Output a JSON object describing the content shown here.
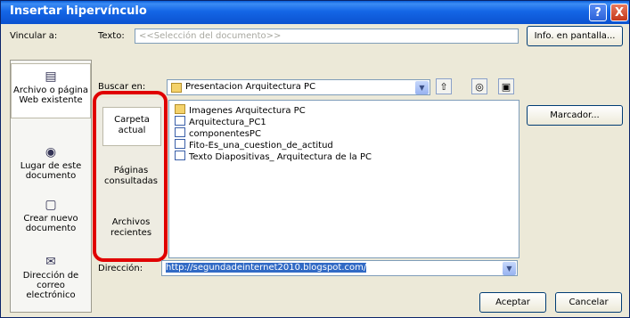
{
  "title": "Insertar hipervínculo",
  "title_buttons": {
    "help": "?",
    "close": "X"
  },
  "link_to_label": "Vincular a:",
  "text_label": "Texto:",
  "text_value": "<<Selección del documento>>",
  "screen_tip_button": "Info. en pantalla...",
  "look_in_label": "Buscar en:",
  "look_in_value": "Presentacion Arquitectura PC",
  "left_links": [
    {
      "label": "Archivo o página Web existente",
      "icon": "globe-document-icon"
    },
    {
      "label": "Lugar de este documento",
      "icon": "place-in-document-icon"
    },
    {
      "label": "Crear nuevo documento",
      "icon": "new-document-icon"
    },
    {
      "label": "Dirección de correo electrónico",
      "icon": "email-icon"
    }
  ],
  "mid_links": [
    {
      "label": "Carpeta actual"
    },
    {
      "label": "Páginas consultadas"
    },
    {
      "label": "Archivos recientes"
    }
  ],
  "files": [
    {
      "name": "Imagenes Arquitectura PC",
      "icon": "folder-icon"
    },
    {
      "name": "Arquitectura_PC1",
      "icon": "document-icon"
    },
    {
      "name": "componentesPC",
      "icon": "document-icon"
    },
    {
      "name": "Fito-Es_una_cuestion_de_actitud",
      "icon": "document-icon"
    },
    {
      "name": "Texto Diapositivas_ Arquitectura de la PC",
      "icon": "document-icon"
    }
  ],
  "bookmark_button": "Marcador...",
  "address_label": "Dirección:",
  "address_value": "http://segundadeinternet2010.blogspot.com/",
  "ok_button": "Aceptar",
  "cancel_button": "Cancelar",
  "colors": {
    "titlebar": "#0a5fd8",
    "highlight": "#e00000",
    "dialog_bg": "#ece9d8"
  }
}
